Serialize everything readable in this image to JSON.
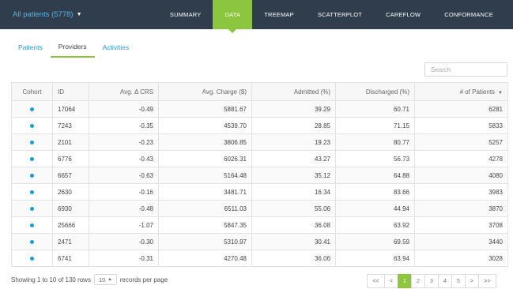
{
  "header": {
    "patient_selector": "All patients (5778)",
    "nav": [
      "SUMMARY",
      "DATA",
      "TREEMAP",
      "SCATTERPLOT",
      "CAREFLOW",
      "CONFORMANCE"
    ],
    "active_nav": "DATA"
  },
  "subtabs": [
    "Patients",
    "Providers",
    "Activities"
  ],
  "active_subtab": "Providers",
  "search": {
    "placeholder": "Search"
  },
  "table": {
    "columns": [
      "Cohort",
      "ID",
      "Avg. Δ CRS",
      "Avg. Charge ($)",
      "Admitted (%)",
      "Discharged (%)",
      "# of Patients"
    ],
    "sorted_column": "# of Patients",
    "cohort_color": "#1a9ad7",
    "rows": [
      {
        "id": "17064",
        "crs": "-0.49",
        "charge": "5881.67",
        "admitted": "39.29",
        "discharged": "60.71",
        "patients": "6281"
      },
      {
        "id": "7243",
        "crs": "-0.35",
        "charge": "4539.70",
        "admitted": "28.85",
        "discharged": "71.15",
        "patients": "5833"
      },
      {
        "id": "2101",
        "crs": "-0.23",
        "charge": "3806.85",
        "admitted": "19.23",
        "discharged": "80.77",
        "patients": "5257"
      },
      {
        "id": "6776",
        "crs": "-0.43",
        "charge": "6026.31",
        "admitted": "43.27",
        "discharged": "56.73",
        "patients": "4278"
      },
      {
        "id": "6657",
        "crs": "-0.63",
        "charge": "5164.48",
        "admitted": "35.12",
        "discharged": "64.88",
        "patients": "4080"
      },
      {
        "id": "2630",
        "crs": "-0.16",
        "charge": "3481.71",
        "admitted": "16.34",
        "discharged": "83.66",
        "patients": "3983"
      },
      {
        "id": "6930",
        "crs": "-0.48",
        "charge": "6511.03",
        "admitted": "55.06",
        "discharged": "44.94",
        "patients": "3870"
      },
      {
        "id": "25666",
        "crs": "-1.07",
        "charge": "5847.35",
        "admitted": "36.08",
        "discharged": "63.92",
        "patients": "3708"
      },
      {
        "id": "2471",
        "crs": "-0.30",
        "charge": "5310.97",
        "admitted": "30.41",
        "discharged": "69.59",
        "patients": "3440"
      },
      {
        "id": "6741",
        "crs": "-0.31",
        "charge": "4270.48",
        "admitted": "36.06",
        "discharged": "63.94",
        "patients": "3028"
      }
    ]
  },
  "footer": {
    "showing_text": "Showing 1 to 10 of 130 rows",
    "per_page": "10",
    "per_page_suffix": "records per page"
  },
  "pagination": {
    "first": "<<",
    "prev": "<",
    "pages": [
      "1",
      "2",
      "3",
      "4",
      "5"
    ],
    "current": "1",
    "next": ">",
    "last": ">>"
  },
  "colors": {
    "header_bg": "#2f3d4c",
    "accent": "#8cc63f",
    "link": "#2a9bd6"
  }
}
